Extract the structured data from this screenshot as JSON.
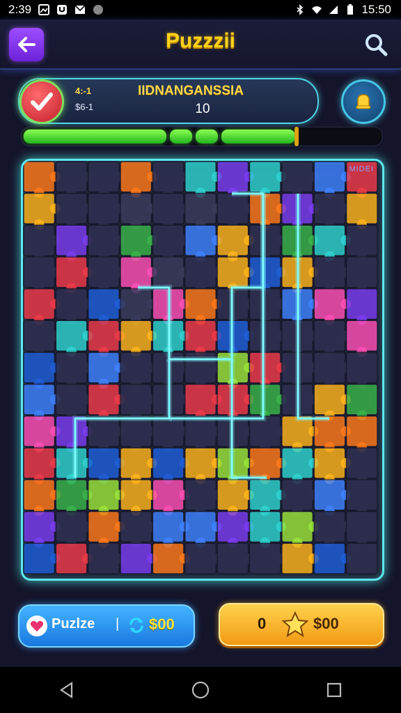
{
  "status_bar": {
    "time": "2:39",
    "clock": "15:50"
  },
  "header": {
    "title": "Puzzzii"
  },
  "info": {
    "stat_top": "4:-1",
    "stat_bottom": "$6-1",
    "level_name": "IIDNANGANSSIA",
    "level_number": "10"
  },
  "progress": {
    "fraction": 0.77,
    "segments": 4
  },
  "board": {
    "tag": "MIDEI",
    "rows": 13,
    "cols": 11,
    "palette": [
      "#2e2f4f",
      "#ef3b49",
      "#3f82ff",
      "#7a3df0",
      "#39b54a",
      "#ffb51b",
      "#ff7a1a",
      "#2fd4d0",
      "#ff4fb5",
      "#9be53a",
      "#1e5fd8",
      "#3a3c5c"
    ],
    "highlight_color": "#7dfcff"
  },
  "buttons": {
    "puzzle_label": "Puzlze",
    "puzzle_separator": "|",
    "puzzle_value": "$00",
    "coin_count": "0",
    "coin_value": "$00"
  },
  "icons": {
    "back": "arrow-left-icon",
    "search": "search-icon",
    "bell": "bell-icon",
    "check": "check-icon",
    "heart": "heart-icon",
    "sync": "sync-icon",
    "star": "star-icon"
  }
}
